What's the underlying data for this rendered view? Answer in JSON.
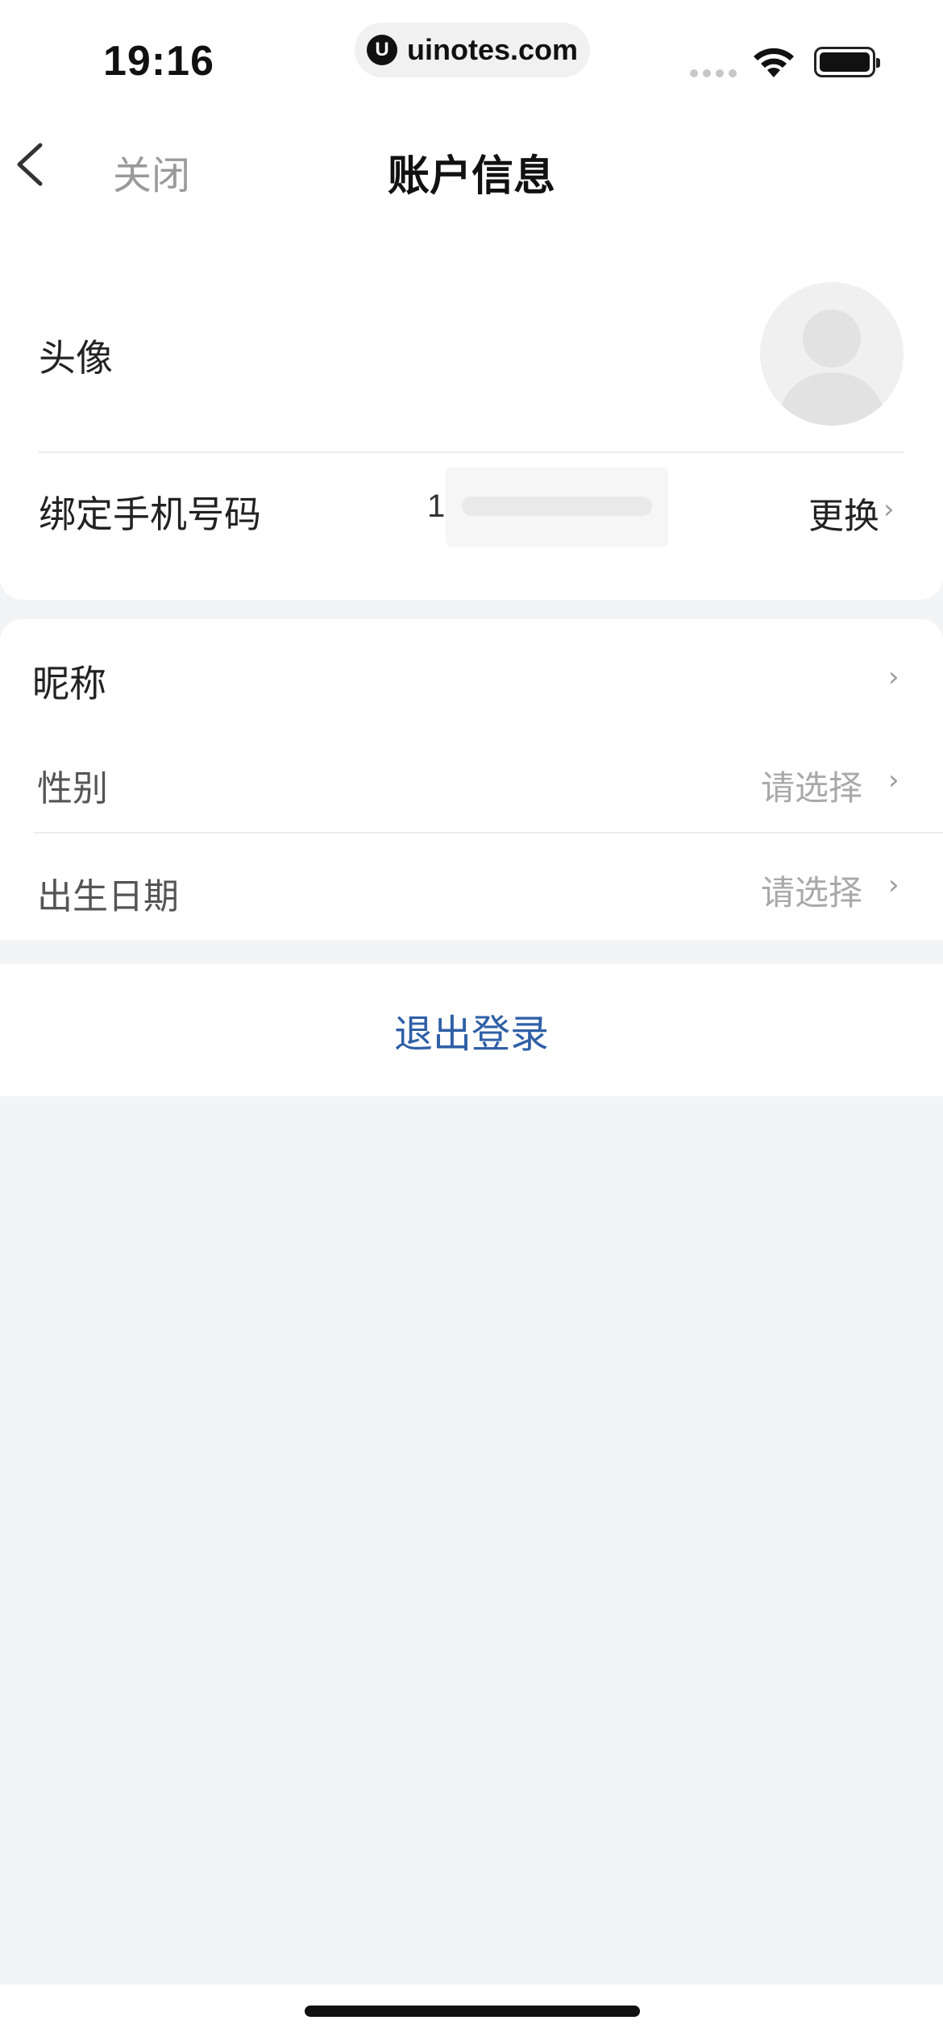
{
  "status_bar": {
    "time": "19:16",
    "url": "uinotes.com",
    "url_icon": "U"
  },
  "nav": {
    "back_icon": "chevron-left-icon",
    "close_label": "关闭",
    "title": "账户信息"
  },
  "account_card": {
    "avatar_label": "头像",
    "phone_label": "绑定手机号码",
    "phone_value_visible": "1",
    "change_label": "更换"
  },
  "profile_card": {
    "nickname_label": "昵称",
    "gender_label": "性别",
    "gender_placeholder": "请选择",
    "birthday_label": "出生日期",
    "birthday_placeholder": "请选择"
  },
  "logout": {
    "label": "退出登录"
  },
  "colors": {
    "background": "#f3f4f6",
    "card": "#ffffff",
    "logout_text": "#2f5fa7",
    "muted_text": "#a9a9a9"
  }
}
